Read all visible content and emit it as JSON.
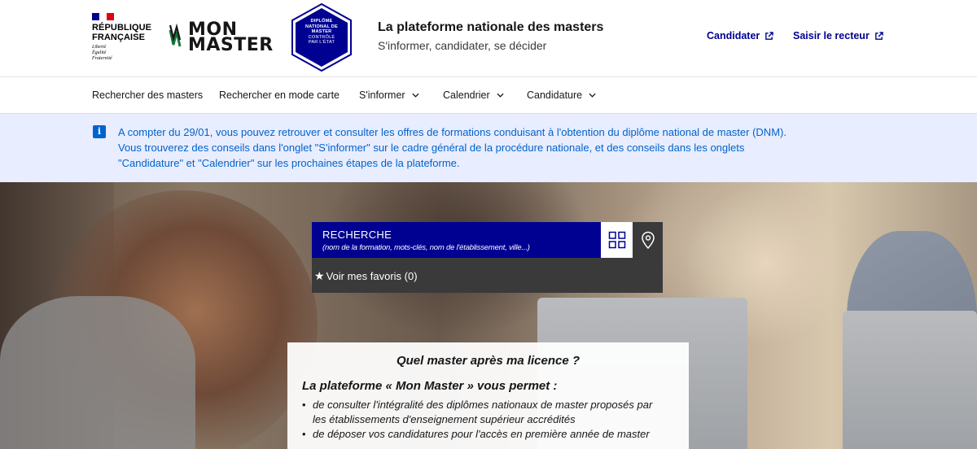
{
  "header": {
    "republic": {
      "line1": "RÉPUBLIQUE",
      "line2": "FRANÇAISE",
      "motto1": "Liberté",
      "motto2": "Égalité",
      "motto3": "Fraternité"
    },
    "logo": {
      "line1": "MON",
      "line2": "MASTER"
    },
    "badge": {
      "line1": "DIPLÔME",
      "line2": "NATIONAL DE",
      "line3": "MASTER",
      "line4": "CONTRÔLÉ",
      "line5": "PAR L'ÉTAT"
    },
    "title": "La plateforme nationale des masters",
    "subtitle": "S'informer, candidater, se décider",
    "links": [
      {
        "label": "Candidater"
      },
      {
        "label": "Saisir le recteur"
      }
    ]
  },
  "nav": {
    "items": [
      {
        "label": "Rechercher des masters"
      },
      {
        "label": "Rechercher en mode carte"
      },
      {
        "label": "S'informer"
      },
      {
        "label": "Calendrier"
      },
      {
        "label": "Candidature"
      }
    ]
  },
  "notice": {
    "line1": "A compter du 29/01, vous pouvez retrouver et consulter les offres de formations conduisant à l'obtention du diplôme national de master (DNM).",
    "line2": "Vous trouverez des conseils dans l'onglet \"S'informer\" sur le cadre général de la procédure nationale, et des conseils dans les onglets",
    "line3": "\"Candidature\" et \"Calendrier\" sur les prochaines étapes de la plateforme."
  },
  "search": {
    "title": "RECHERCHE",
    "hint": "(nom de la formation, mots-clés, nom de l'établissement, ville...)",
    "favorites": "Voir mes favoris (0)"
  },
  "card": {
    "title": "Quel master après ma licence ?",
    "subtitle": "La plateforme « Mon Master » vous permet :",
    "items": [
      {
        "line1": "de consulter l'intégralité des diplômes nationaux de master proposés par",
        "line2": "les établissements d'enseignement supérieur accrédités"
      },
      {
        "line1": "de déposer vos candidatures pour l'accès en première année de master"
      }
    ]
  },
  "colors": {
    "primary": "#000091",
    "info": "#0063cb",
    "notice_bg": "#e8edff",
    "panel": "#3a3a3a"
  }
}
